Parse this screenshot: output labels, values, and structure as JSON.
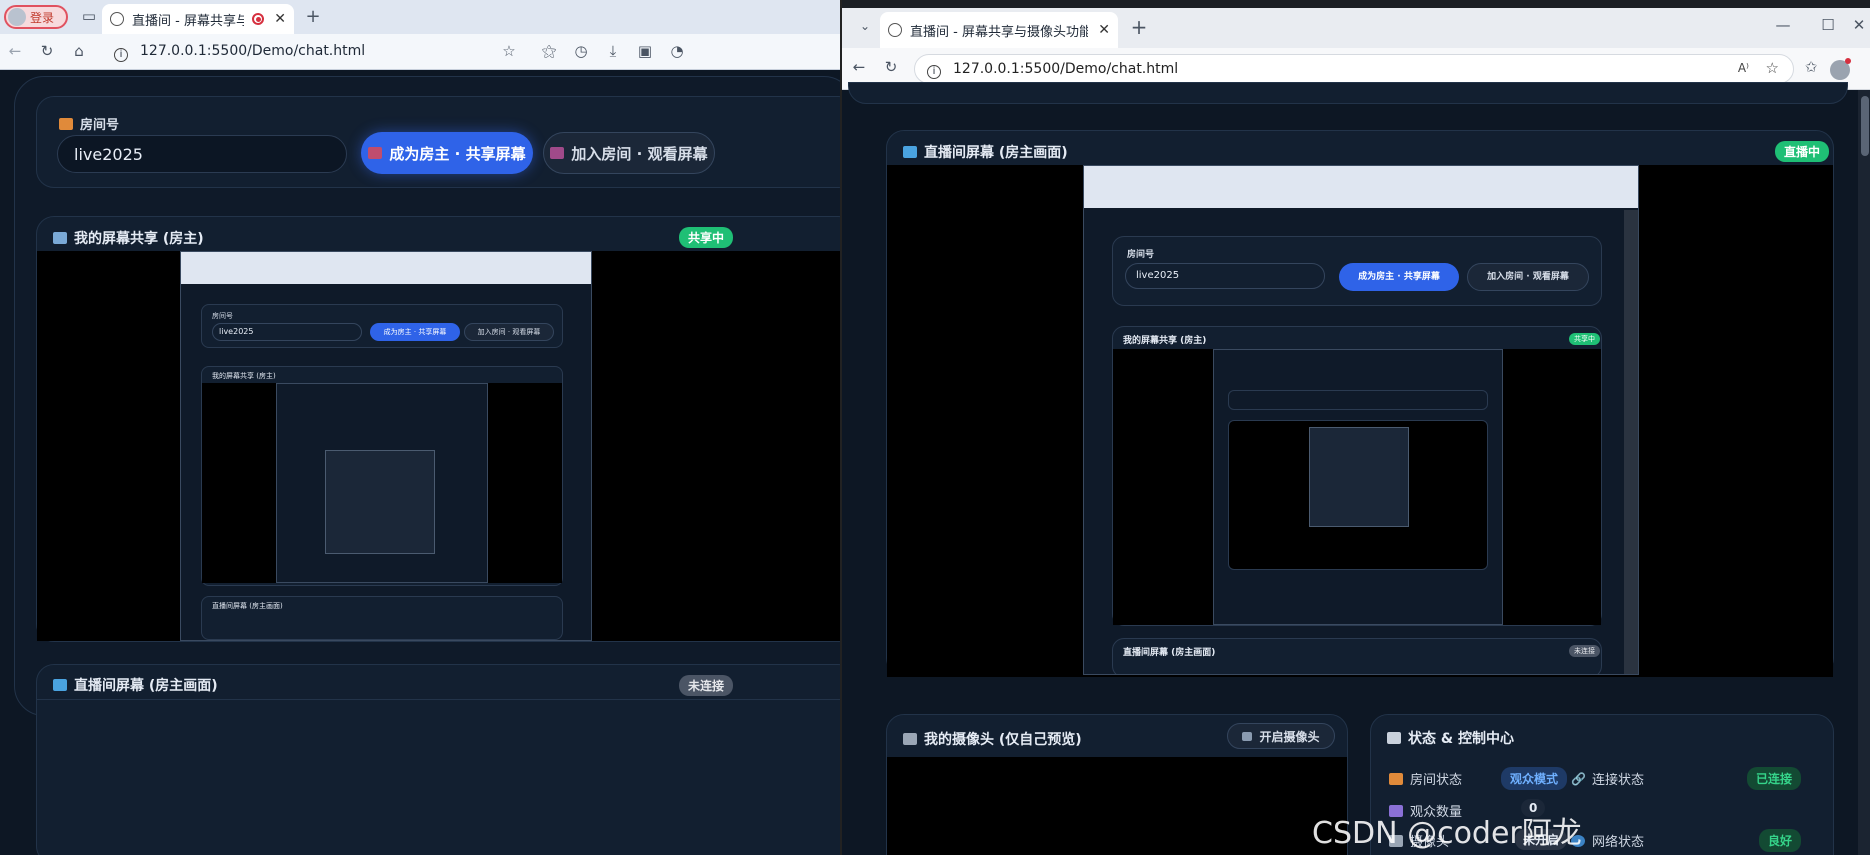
{
  "left_window": {
    "login_label": "登录",
    "tab_title": "直播间 - 屏幕共享与摄像头",
    "url": "127.0.0.1:5500/Demo/chat.html",
    "room": {
      "label": "房间号",
      "value": "live2025",
      "host_button": "成为房主 · 共享屏幕",
      "join_button": "加入房间 · 观看屏幕"
    },
    "my_share": {
      "title": "我的屏幕共享 (房主)",
      "badge": "共享中"
    },
    "live_screen": {
      "title": "直播间屏幕 (房主画面)",
      "badge": "未连接"
    }
  },
  "right_window": {
    "tab_title": "直播间 - 屏幕共享与摄像头功能",
    "url": "127.0.0.1:5500/Demo/chat.html",
    "live_screen": {
      "title": "直播间屏幕 (房主画面)",
      "badge": "直播中"
    },
    "camera": {
      "title": "我的摄像头 (仅自己预览)",
      "button": "开启摄像头"
    },
    "status": {
      "title": "状态 & 控制中心",
      "rows": [
        {
          "label": "房间状态",
          "value": "观众模式"
        },
        {
          "label": "连接状态",
          "value": "已连接"
        },
        {
          "label": "观众数量",
          "value": "0"
        },
        {
          "label": "摄像头",
          "value": "未开启"
        },
        {
          "label": "网络状态",
          "value": "良好"
        }
      ]
    },
    "nested_preview": {
      "room_label": "房间号",
      "room_value": "live2025",
      "host_button": "成为房主 · 共享屏幕",
      "join_button": "加入房间 · 观看屏幕",
      "share_title": "我的屏幕共享 (房主)",
      "share_badge": "共享中",
      "live_title": "直播间屏幕 (房主画面)",
      "live_badge": "未连接"
    }
  },
  "watermark": "CSDN @coder阿龙",
  "colors": {
    "primary": "#2f63e8",
    "success": "#1fbf75",
    "panel": "#121f30",
    "background": "#0d1724"
  }
}
